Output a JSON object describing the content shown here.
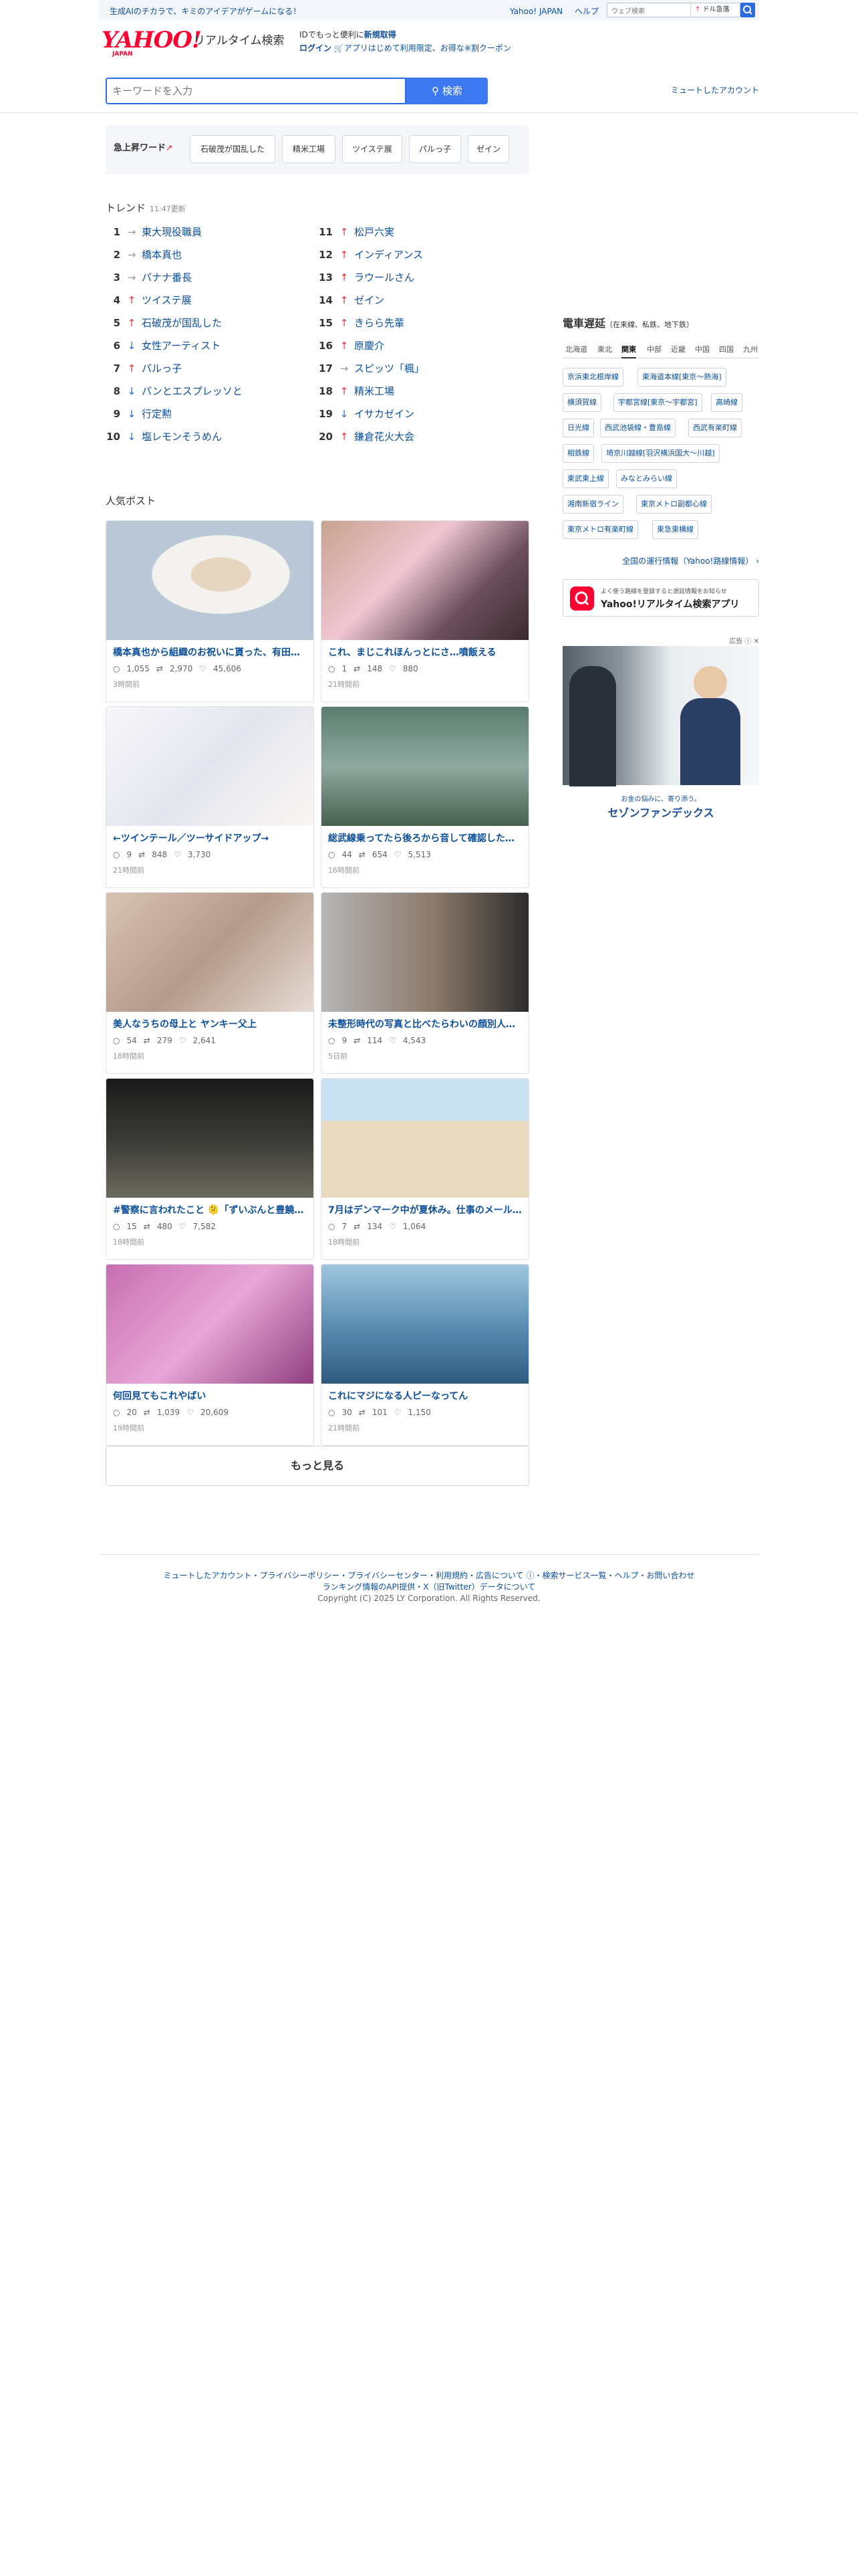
{
  "topbar": {
    "promo": "生成AIのチカラで、キミのアイデアがゲームになる！",
    "links": [
      "Yahoo! JAPAN",
      "ヘルプ"
    ],
    "websearch_placeholder": "ウェブ検索",
    "websearch_label": "ドル急落"
  },
  "header": {
    "logo": "YAHOO!",
    "logo_sub": "JAPAN",
    "title": "リアルタイム検索",
    "id_line1_prefix": "IDでもっと便利に",
    "id_line1_link": "新規取得",
    "id_line2_login": "ログイン",
    "id_line2_rest": "アプリはじめて利用限定、お得な※割クーポン"
  },
  "search": {
    "placeholder": "キーワードを入力",
    "button_label": "検索",
    "mute_link": "ミュートしたアカウント"
  },
  "rising": {
    "label": "急上昇ワード",
    "chips": [
      "石破茂が国乱した",
      "精米工場",
      "ツイステ展",
      "パルっ子",
      "ゼイン"
    ]
  },
  "trend": {
    "title": "トレンド",
    "updated": "11:47更新",
    "items": [
      {
        "rank": "1",
        "dir": "fl",
        "name": "東大現役職員"
      },
      {
        "rank": "2",
        "dir": "fl",
        "name": "橋本真也"
      },
      {
        "rank": "3",
        "dir": "fl",
        "name": "パナナ番長"
      },
      {
        "rank": "4",
        "dir": "up",
        "name": "ツイステ展"
      },
      {
        "rank": "5",
        "dir": "up",
        "name": "石破茂が国乱した"
      },
      {
        "rank": "6",
        "dir": "dn",
        "name": "女性アーティスト"
      },
      {
        "rank": "7",
        "dir": "up",
        "name": "パルっ子"
      },
      {
        "rank": "8",
        "dir": "dn",
        "name": "パンとエスプレッソと"
      },
      {
        "rank": "9",
        "dir": "dn",
        "name": "行定勲"
      },
      {
        "rank": "10",
        "dir": "dn",
        "name": "塩レモンそうめん"
      },
      {
        "rank": "11",
        "dir": "up",
        "name": "松戸六実"
      },
      {
        "rank": "12",
        "dir": "up",
        "name": "インディアンス"
      },
      {
        "rank": "13",
        "dir": "up",
        "name": "ラウールさん"
      },
      {
        "rank": "14",
        "dir": "up",
        "name": "ゼイン"
      },
      {
        "rank": "15",
        "dir": "up",
        "name": "きらら先輩"
      },
      {
        "rank": "16",
        "dir": "up",
        "name": "原慶介"
      },
      {
        "rank": "17",
        "dir": "fl",
        "name": "スピッツ「楓」"
      },
      {
        "rank": "18",
        "dir": "up",
        "name": "精米工場"
      },
      {
        "rank": "19",
        "dir": "dn",
        "name": "イサカゼイン"
      },
      {
        "rank": "20",
        "dir": "up",
        "name": "鎌倉花火大会"
      }
    ]
  },
  "popular": {
    "title": "人気ポスト",
    "cards": [
      {
        "caption": "橋本真也から組織のお祝いに貰った、有田焼の…",
        "replies": "1,055",
        "retweets": "2,970",
        "likes": "45,606",
        "time": "3時間前",
        "theme": "bowl"
      },
      {
        "caption": "これ、まじこれほんっとにさ…噴飯える",
        "replies": "1",
        "retweets": "148",
        "likes": "880",
        "time": "21時間前",
        "theme": "anime"
      },
      {
        "caption": "←ツインテール／ツーサイドアップ→",
        "replies": "9",
        "retweets": "848",
        "likes": "3,730",
        "time": "21時間前",
        "theme": "sketch"
      },
      {
        "caption": "総武線乗ってたら後ろから音して確認したら…",
        "replies": "44",
        "retweets": "654",
        "likes": "5,513",
        "time": "16時間前",
        "theme": "train"
      },
      {
        "caption": "美人なうちの母上と ヤンキー父上",
        "replies": "54",
        "retweets": "279",
        "likes": "2,641",
        "time": "18時間前",
        "theme": "photo"
      },
      {
        "caption": "未整形時代の写真と比べたらわいの顔別人…",
        "replies": "9",
        "retweets": "114",
        "likes": "4,543",
        "time": "5日前",
        "theme": "face"
      },
      {
        "caption": "#警察に言われたこと 🫠「ずいぶんと豊饒潔…",
        "replies": "15",
        "retweets": "480",
        "likes": "7,582",
        "time": "18時間前",
        "theme": "night"
      },
      {
        "caption": "7月はデンマーク中が夏休み。仕事のメール…",
        "replies": "7",
        "retweets": "134",
        "likes": "1,064",
        "time": "18時間前",
        "theme": "beach"
      },
      {
        "caption": "何回見てもこれやばい",
        "replies": "20",
        "retweets": "1,039",
        "likes": "20,609",
        "time": "19時間前",
        "theme": "pink"
      },
      {
        "caption": "これにマジになる人ピーなってん",
        "replies": "30",
        "retweets": "101",
        "likes": "1,150",
        "time": "21時間前",
        "theme": "poster"
      }
    ],
    "more_label": "もっと見る"
  },
  "sidebar": {
    "title": "電車遅延",
    "subtitle": "（在来線、私鉄、地下鉄）",
    "tabs": [
      "北海道",
      "東北",
      "関東",
      "中部",
      "近畿",
      "中国",
      "四国",
      "九州"
    ],
    "active_tab": "関東",
    "lines": [
      "京浜東北根岸線",
      "東海道本線[東京〜熱海]",
      "横須賀線",
      "宇都宮線[東京〜宇都宮]",
      "高崎線",
      "日光線",
      "西武池袋線・豊島線",
      "西武有楽町線",
      "相鉄線",
      "埼京川越線[羽沢横浜国大〜川越]",
      "東武東上線",
      "みなとみらい線",
      "湘南新宿ライン",
      "東京メトロ副都心線",
      "東京メトロ有楽町線",
      "東急東横線"
    ],
    "all_info": "全国の運行情報（Yahoo!路線情報）",
    "app_banner_small": "よく使う路線を登録すると遅延情報をお知らせ",
    "app_banner_title": "Yahoo!リアルタイム検索アプリ",
    "ad_label": "広告",
    "ad_tagline": "お金の悩みに、寄り添う。",
    "ad_brand": "セゾンファンデックス"
  },
  "footer": {
    "links_line1": "ミュートしたアカウント・プライバシーポリシー・プライバシーセンター・利用規約・広告について ⓘ・検索サービス一覧・ヘルプ・お問い合わせ",
    "links_line2": "ランキング情報のAPI提供・X（旧Twitter）データについて",
    "copyright": "Copyright (C) 2025 LY Corporation. All Rights Reserved."
  },
  "colors": {
    "accent": "#3d7af2",
    "link": "#0b4f9c",
    "up": "#e8333c",
    "down": "#1e6ad6",
    "logo": "#ff0033"
  }
}
